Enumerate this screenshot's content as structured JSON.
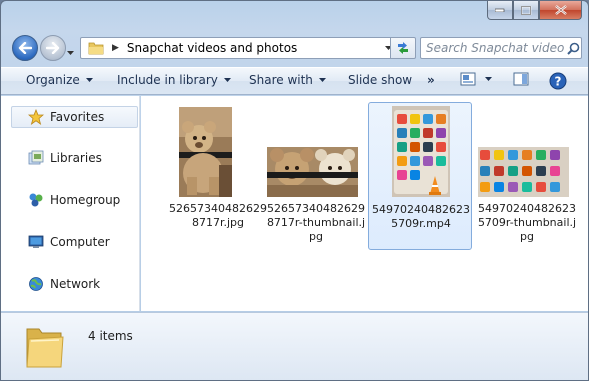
{
  "window": {
    "caption_buttons": [
      "minimize",
      "maximize",
      "close"
    ]
  },
  "address": {
    "path": "Snapchat videos and photos",
    "search_placeholder": "Search Snapchat video..."
  },
  "toolbar": {
    "organize": "Organize",
    "include_in_library": "Include in library",
    "share_with": "Share with",
    "slide_show": "Slide show",
    "more": "»"
  },
  "sidebar": {
    "items": [
      {
        "label": "Favorites",
        "icon": "star-icon"
      },
      {
        "label": "Libraries",
        "icon": "libraries-icon"
      },
      {
        "label": "Homegroup",
        "icon": "homegroup-icon"
      },
      {
        "label": "Computer",
        "icon": "computer-icon"
      },
      {
        "label": "Network",
        "icon": "network-icon"
      }
    ]
  },
  "files": [
    {
      "name": "526573404826298717r.jpg",
      "kind": "image"
    },
    {
      "name": "526573404826298717r-thumbnail.jpg",
      "kind": "image"
    },
    {
      "name": "549702404826235709r.mp4",
      "kind": "video"
    },
    {
      "name": "549702404826235709r-thumbnail.jpg",
      "kind": "image"
    }
  ],
  "details": {
    "item_count": "4 items"
  },
  "colors": {
    "accent": "#2c6ac0",
    "selection_border": "#84acdd",
    "window_frame": "#b9d1ea"
  }
}
